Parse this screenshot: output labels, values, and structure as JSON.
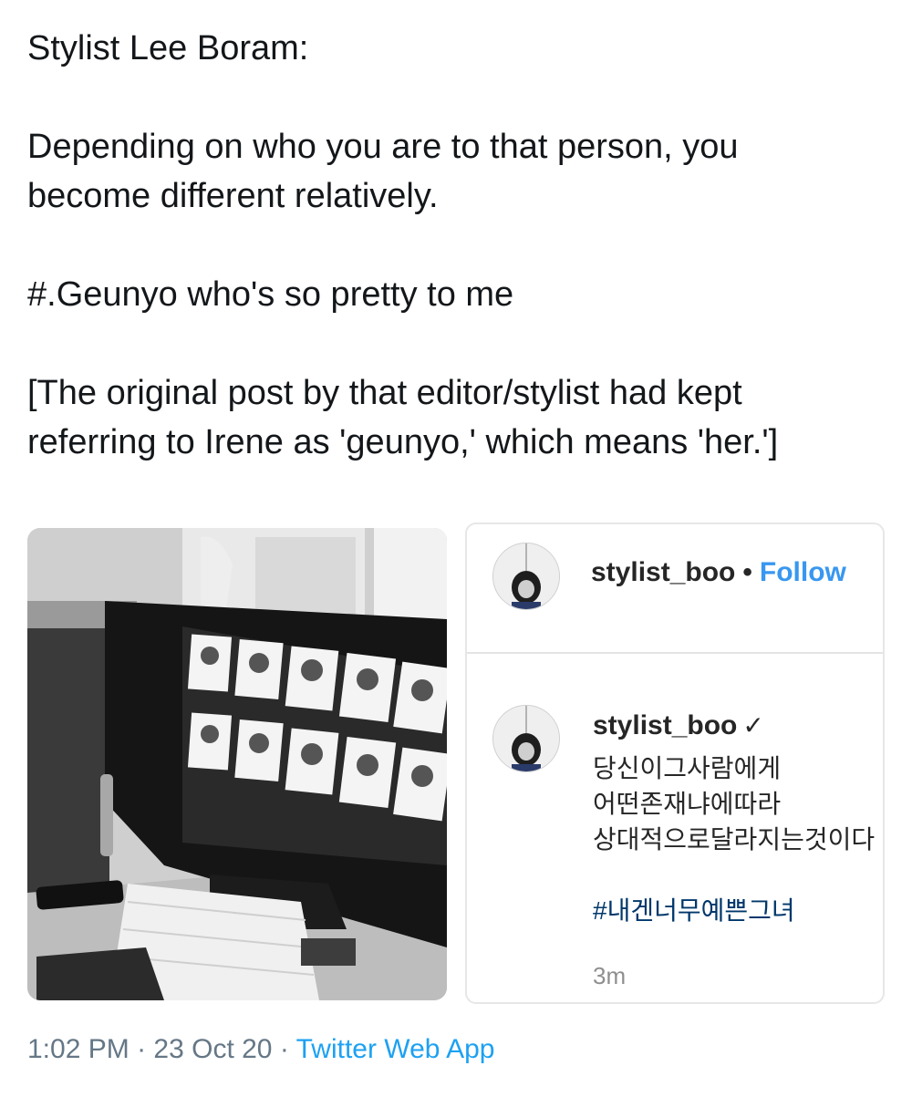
{
  "tweet": {
    "lines": {
      "l1": "Stylist Lee Boram:",
      "l2": "Depending on who you are to that person, you",
      "l3": "become different relatively.",
      "l4": "#.Geunyo who's so pretty to me",
      "l5": "[The original post by that editor/stylist had kept",
      "l6": "referring to Irene as 'geunyo,' which means 'her.']"
    },
    "time": "1:02 PM",
    "sep1": " · ",
    "date": "23 Oct 20",
    "sep2": " · ",
    "source": "Twitter Web App"
  },
  "instagram": {
    "username": "stylist_boo",
    "separator": "•",
    "follow_label": "Follow",
    "comment": {
      "username": "stylist_boo",
      "verified_mark": "✓",
      "caption": {
        "l1": "당신이그사람에게",
        "l2": "어떤존재냐에따라",
        "l3": "상대적으로달라지는것이다",
        "hashtag": "#내겐너무예쁜그녀"
      },
      "time": "3m"
    }
  },
  "colors": {
    "text": "#14171a",
    "meta": "#657786",
    "link": "#1da1f2",
    "ig_follow": "#3897f0",
    "ig_hashtag": "#00376b"
  },
  "icons": {
    "photo": "monitor-photo-image",
    "avatar": "profile-avatar-image"
  }
}
